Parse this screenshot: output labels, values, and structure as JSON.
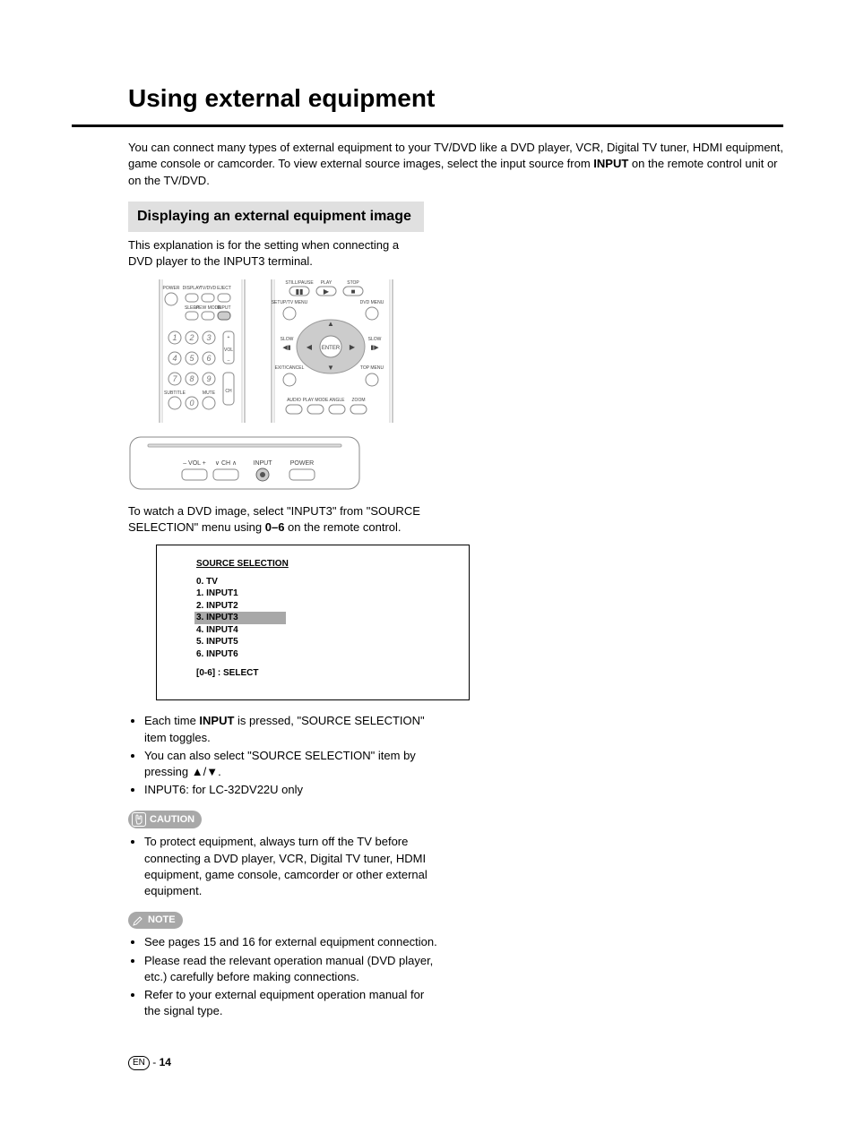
{
  "title": "Using external equipment",
  "intro": "You can connect many types of external equipment to your TV/DVD like a DVD player, VCR, Digital TV tuner, HDMI equipment, game console or camcorder. To view external source images, select the input source from INPUT on the remote control unit or on the TV/DVD.",
  "intro_bold": "INPUT",
  "section_heading": "Displaying an external equipment image",
  "explanation": "This explanation is for the setting when connecting a DVD player to the INPUT3 terminal.",
  "watch_para_a": "To watch a DVD image, select \"INPUT3\" from \"SOURCE SELECTION\" menu using ",
  "watch_para_bold": "0–6",
  "watch_para_b": " on the remote control.",
  "osd": {
    "title": "SOURCE SELECTION",
    "items": [
      "0.   TV",
      "1.   INPUT1",
      "2.   INPUT2",
      "3.   INPUT3",
      "4.   INPUT4",
      "5.   INPUT5",
      "6.   INPUT6"
    ],
    "selected_index": 3,
    "select_hint": "[0-6] : SELECT"
  },
  "bullets_main": [
    "Each time INPUT is pressed, \"SOURCE SELECTION\" item toggles.",
    "You can also select \"SOURCE SELECTION\" item by pressing ▲/▼.",
    "INPUT6: for LC-32DV22U only"
  ],
  "caution_label": "CAUTION",
  "caution_bullets": [
    "To protect equipment, always turn off the TV before connecting a DVD player, VCR, Digital TV tuner, HDMI equipment, game console, camcorder or other external equipment."
  ],
  "note_label": "NOTE",
  "note_bullets": [
    "See pages 15 and 16 for external equipment connection.",
    "Please read the relevant operation manual (DVD player, etc.) carefully before making connections.",
    "Refer to your external equipment operation manual for the signal type."
  ],
  "remote_left": {
    "row1": [
      "POWER",
      "DISPLAY",
      "TV/DVD",
      "EJECT"
    ],
    "row2": [
      "SLEEP",
      "VIEW MODE",
      "INPUT"
    ],
    "side_labels": [
      "VOL",
      "CH"
    ],
    "bottom": [
      "SUBTITLE",
      "MUTE"
    ]
  },
  "remote_right": {
    "row1": [
      "STILL/PAUSE",
      "PLAY",
      "STOP"
    ],
    "side1": [
      "SETUP/TV MENU",
      "DVD MENU"
    ],
    "slow": "SLOW",
    "enter": "ENTER",
    "side2": [
      "EXIT/CANCEL",
      "TOP MENU"
    ],
    "row3": [
      "AUDIO",
      "PLAY MODE",
      "ANGLE",
      "ZOOM"
    ]
  },
  "front_panel": {
    "labels": [
      "– VOL +",
      "∨ CH ∧",
      "INPUT",
      "POWER"
    ]
  },
  "page": {
    "lang": "EN",
    "sep": " - ",
    "num": "14"
  }
}
